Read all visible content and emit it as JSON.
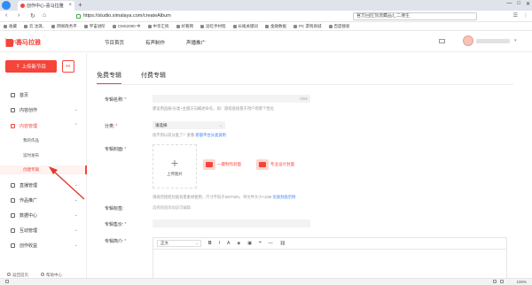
{
  "browser": {
    "tab_title": "创作中心-喜马拉雅",
    "tab_new": "+",
    "url": "https://studio.ximalaya.com/createAlbum",
    "search_placeholder": "官方回应顶流藏品汇二港生",
    "nav_back": "‹",
    "nav_forward": "›",
    "nav_reload": "↻",
    "nav_home": "⌂",
    "window_controls": [
      "—",
      "□",
      "✕"
    ],
    "right_tools": [
      "☰",
      "⋮"
    ],
    "bookmarks": [
      "收藏",
      "云 沈煞..",
      "网易政务平",
      "宇宙进阶",
      "CMS2000 中",
      "中华汇统",
      "好看网",
      "追吃手材程",
      "长尾关键词",
      "金融数据",
      "PC 游戏商城",
      "百度搜索"
    ]
  },
  "header": {
    "brand": "喜马拉雅",
    "brand_sub": "创作中心",
    "nav": [
      "节目首页",
      "有声制作",
      "声播推广"
    ]
  },
  "sidebar": {
    "upload_label": "上传新节目",
    "upload_icon": "upload-icon",
    "scissor_icon": "scissors-icon",
    "items": [
      {
        "label": "首页",
        "icon": "home-icon"
      },
      {
        "label": "内容创作",
        "icon": "edit-icon"
      },
      {
        "label": "内容管理",
        "icon": "folder-icon"
      }
    ],
    "sub_items": [
      "我的作品",
      "追时发布",
      "创建专辑"
    ],
    "items2": [
      {
        "label": "直播管理",
        "icon": "broadcast-icon"
      },
      {
        "label": "作品推广",
        "icon": "megaphone-icon"
      },
      {
        "label": "数据中心",
        "icon": "chart-icon"
      },
      {
        "label": "互动管理",
        "icon": "chat-icon"
      },
      {
        "label": "创作收益",
        "icon": "money-icon"
      }
    ],
    "footer": [
      "返回首页",
      "帮助中心"
    ]
  },
  "main": {
    "tabs": [
      "免费专辑",
      "付费专辑"
    ],
    "fields": {
      "album_name_label": "专辑名称:",
      "album_name_placeholder": "",
      "album_name_counter": "0/55",
      "album_name_hint": "建议用品质/分类+主题方向概述命名，如：旅程直接基于用户场景个性化",
      "category_label": "分类:",
      "category_value": "请选择",
      "category_hint": "找不到以前分类了？查看",
      "category_hint_link": "新版平台分类说明",
      "cover_label": "专辑封面:",
      "cover_upload": "上传图片",
      "cover_plus": "+",
      "cover_option1": "一键制作封面",
      "cover_option2": "专业设计封面",
      "cover_hint": "请规范授权封面背景素材使用，尺寸不低于500*500，单文件大小<10M",
      "cover_hint_link": "优质封面示例",
      "tags_label": "专辑标签:",
      "tags_placeholder": "选择频道添加该可编辑",
      "price_label": "专辑售价:",
      "intro_label": "专辑简介:",
      "toolbar_format": "正文"
    }
  },
  "statusbar": {
    "zoom": "100%"
  }
}
